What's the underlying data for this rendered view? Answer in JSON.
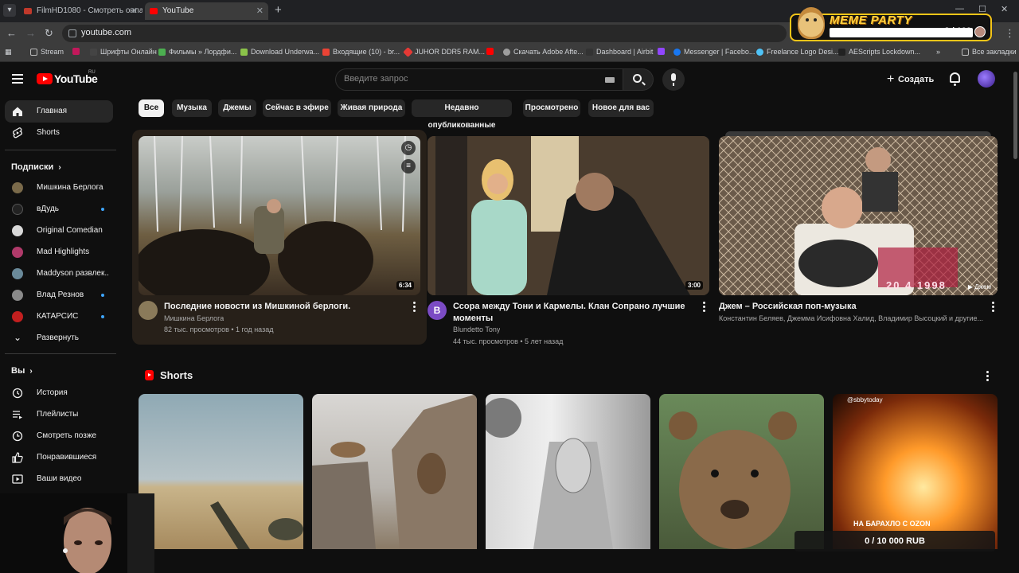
{
  "browser": {
    "tabs": [
      {
        "title": "FilmHD1080 - Смотреть онлай"
      },
      {
        "title": "YouTube"
      }
    ],
    "url": "youtube.com",
    "bookmarks": [
      {
        "label": "Stream",
        "icon": "folder-icon"
      },
      {
        "label": "Шрифты Онлайн",
        "icon": "font-icon"
      },
      {
        "label": "Фильмы » Лордфи...",
        "icon": "film-icon"
      },
      {
        "label": "Download Underwa...",
        "icon": "download-icon"
      },
      {
        "label": "Входящие (10) - br...",
        "icon": "gmail-icon"
      },
      {
        "label": "JUHOR DDR5 RAM...",
        "icon": "store-icon"
      },
      {
        "label": "Скачать Adobe Afte...",
        "icon": "globe-icon"
      },
      {
        "label": "Dashboard | Airbit",
        "icon": "airbit-icon"
      },
      {
        "label": "Messenger | Facebo...",
        "icon": "facebook-icon"
      },
      {
        "label": "Freelance Logo Desi...",
        "icon": "globe-icon"
      },
      {
        "label": "AEScripts Lockdown...",
        "icon": "aescripts-icon"
      },
      {
        "label": "Все закладки",
        "icon": "folder-icon"
      }
    ]
  },
  "meme_widget": {
    "title": "MEME PARTY",
    "count": "2 / 100"
  },
  "header": {
    "logo_text": "YouTube",
    "region": "RU",
    "search_placeholder": "Введите запрос",
    "create_label": "Создать"
  },
  "sidebar": {
    "main": [
      {
        "label": "Главная",
        "icon": "home-icon"
      },
      {
        "label": "Shorts",
        "icon": "shorts-icon"
      }
    ],
    "subscriptions_title": "Подписки",
    "subscriptions": [
      {
        "label": "Мишкина Берлога",
        "color": "#7a6a4a",
        "new": false
      },
      {
        "label": "вДудь",
        "color": "#222222",
        "new": true
      },
      {
        "label": "Original Comedian",
        "color": "#d8d8d8",
        "new": false
      },
      {
        "label": "Mad Highlights",
        "color": "#b03a6a",
        "new": false
      },
      {
        "label": "Maddyson развлек...",
        "color": "#6a8a9a",
        "new": false
      },
      {
        "label": "Влад Резнов",
        "color": "#8a8a8a",
        "new": true
      },
      {
        "label": "КАТАРСИС",
        "color": "#c21f1f",
        "new": true
      }
    ],
    "expand_label": "Развернуть",
    "you_title": "Вы",
    "you_items": [
      {
        "label": "История",
        "icon": "history-icon"
      },
      {
        "label": "Плейлисты",
        "icon": "playlists-icon"
      },
      {
        "label": "Смотреть позже",
        "icon": "watch-later-icon"
      },
      {
        "label": "Понравившиеся",
        "icon": "like-icon"
      },
      {
        "label": "Ваши видео",
        "icon": "your-videos-icon"
      }
    ]
  },
  "chips": [
    "Все",
    "Музыка",
    "Джемы",
    "Сейчас в эфире",
    "Живая природа",
    "Недавно опубликованные",
    "Просмотрено",
    "Новое для вас"
  ],
  "videos": [
    {
      "title": "Последние новости из Мишкиной берлоги.",
      "channel": "Мишкина Берлога",
      "meta": "82 тыс. просмотров • 1 год назад",
      "duration": "6:34"
    },
    {
      "title": "Ссора между Тони и Кармелы. Клан Сопрано лучшие моменты",
      "channel": "Blundetto Tony",
      "meta": "44 тыс. просмотров • 5 лет назад",
      "duration": "3:00",
      "avatar_letter": "B"
    },
    {
      "title": "Джем – Российская поп-музыка",
      "channel": "Константин Беляев, Джемма Исифовна Халид, Владимир Высоцкий и другие...",
      "badge": "Джем",
      "timestamp_overlay": "20 4 1998"
    }
  ],
  "shorts": {
    "title": "Shorts",
    "items": [
      {
        "overlay": ""
      },
      {
        "overlay": ""
      },
      {
        "overlay": ""
      },
      {
        "overlay": ""
      },
      {
        "overlay": "НА БАРАХЛО С OZON",
        "handle": "@sbbytoday"
      }
    ]
  },
  "donation": {
    "text": "0 / 10 000 RUB"
  }
}
